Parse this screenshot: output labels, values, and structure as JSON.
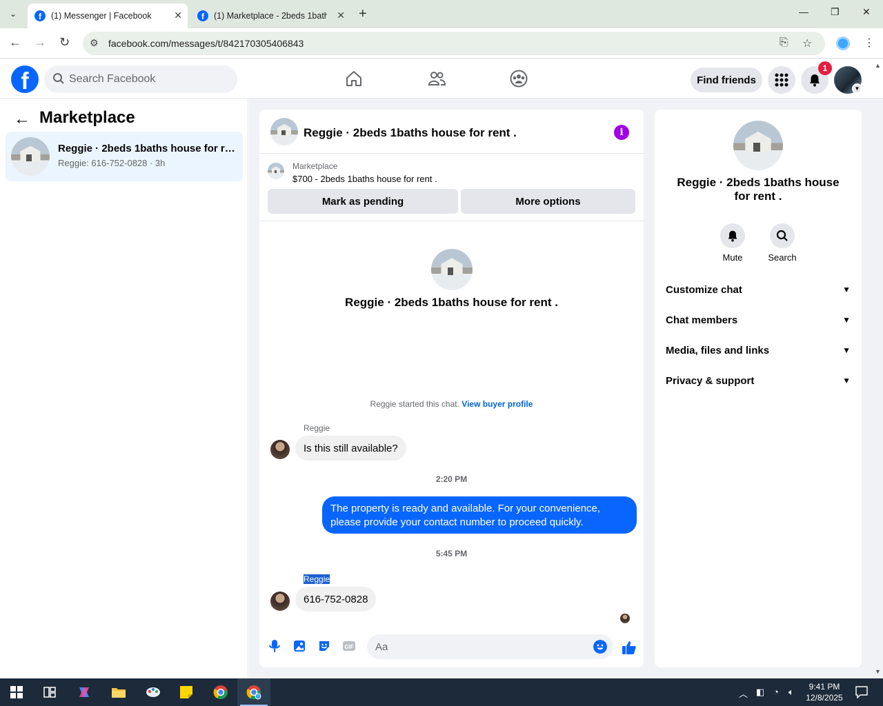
{
  "browser": {
    "tabs": [
      {
        "title": "(1) Messenger | Facebook",
        "active": true
      },
      {
        "title": "(1) Marketplace - 2beds 1baths",
        "active": false
      }
    ],
    "url": "facebook.com/messages/t/842170305406843"
  },
  "fb_header": {
    "search_placeholder": "Search Facebook",
    "find_friends": "Find friends",
    "notification_count": "1"
  },
  "left_panel": {
    "title": "Marketplace",
    "conversation": {
      "name": "Reggie · 2beds 1baths house for rent .",
      "sub": "Reggie: 616-752-0828 · 3h"
    }
  },
  "chat": {
    "title": "Reggie · 2beds 1baths house for rent .",
    "marketplace_label": "Marketplace",
    "listing": "$700 - 2beds 1baths house for rent .",
    "mark_pending": "Mark as pending",
    "more_options": "More options",
    "intro_title": "Reggie · 2beds 1baths house for rent .",
    "started_text": "Reggie started this chat.",
    "view_buyer": "View buyer profile",
    "messages": [
      {
        "sender": "Reggie",
        "text": "Is this still available?"
      },
      {
        "time": "2:20 PM"
      },
      {
        "sender": "me",
        "text": "The property is ready and available. For your convenience, please provide your contact number to proceed quickly."
      },
      {
        "time": "5:45 PM"
      },
      {
        "sender": "Reggie",
        "text": "616-752-0828"
      }
    ],
    "composer_placeholder": "Aa"
  },
  "right_panel": {
    "title": "Reggie · 2beds 1baths house for rent .",
    "mute": "Mute",
    "search": "Search",
    "sections": [
      "Customize chat",
      "Chat members",
      "Media, files and links",
      "Privacy & support"
    ]
  },
  "taskbar": {
    "time": "9:41 PM",
    "date": "12/8/2025"
  },
  "colors": {
    "fb_blue": "#0866ff",
    "info_purple": "#a000e8",
    "badge_red": "#e41e3f",
    "selected_conv": "#ebf5ff"
  }
}
